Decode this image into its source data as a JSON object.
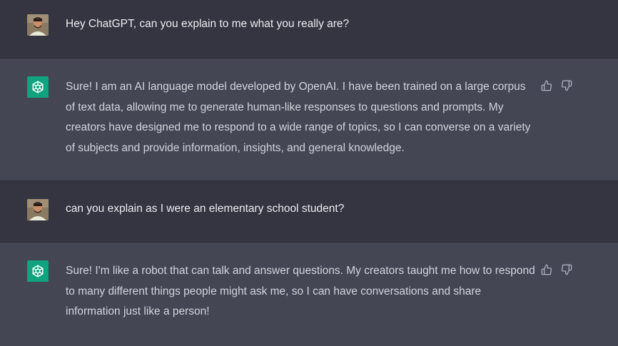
{
  "conversation": {
    "messages": [
      {
        "role": "user",
        "text": "Hey ChatGPT, can you explain to me what you really are?"
      },
      {
        "role": "assistant",
        "text": "Sure! I am an AI language model developed by OpenAI. I have been trained on a large corpus of text data, allowing me to generate human-like responses to questions and prompts. My creators have designed me to respond to a wide range of topics, so I can converse on a variety of subjects and provide information, insights, and general knowledge."
      },
      {
        "role": "user",
        "text": "can you explain as I were an elementary school student?"
      },
      {
        "role": "assistant",
        "text": "Sure! I'm like a robot that can talk and answer questions. My creators taught me how to respond to many different things people might ask me, so I can have conversations and share information just like a person!"
      }
    ]
  },
  "icons": {
    "user_avatar": "user-avatar",
    "assistant_avatar": "openai-logo-icon",
    "thumbs_up": "thumbs-up-icon",
    "thumbs_down": "thumbs-down-icon"
  },
  "colors": {
    "user_bg": "#343541",
    "assistant_bg": "#444654",
    "accent": "#10a37f",
    "text": "#d1d5db"
  }
}
